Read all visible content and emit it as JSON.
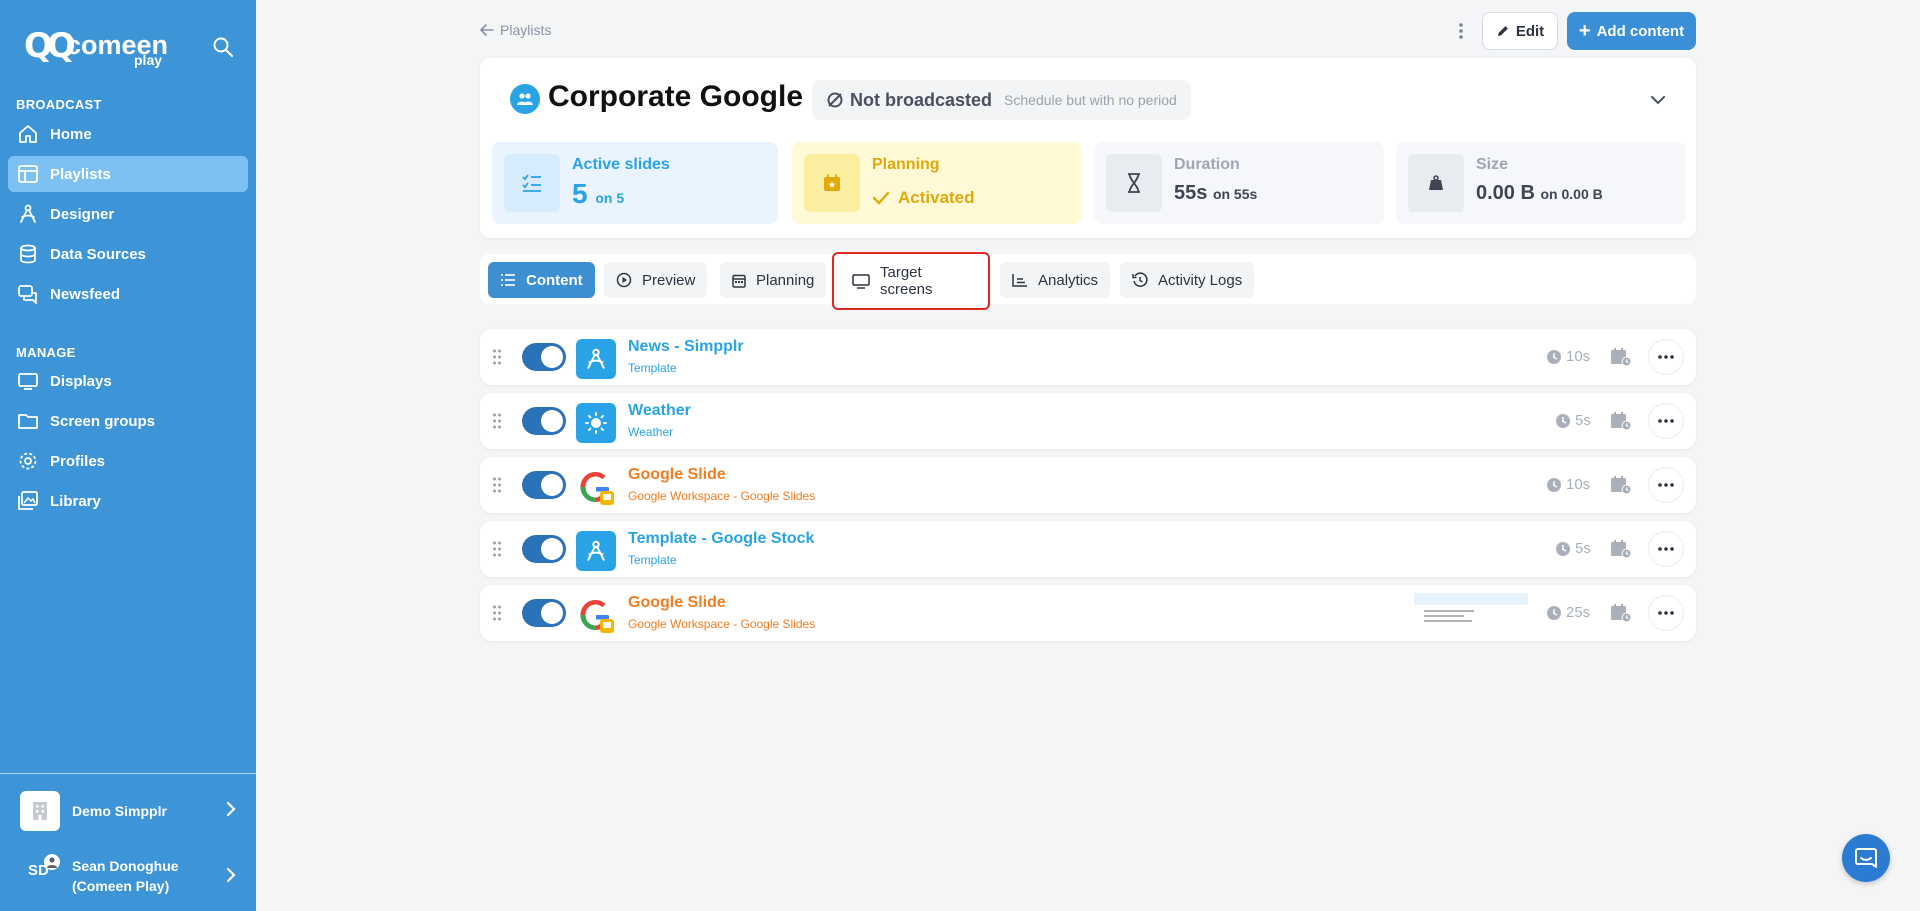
{
  "sidebar": {
    "brand": {
      "mark": "QQ",
      "name": "comeen",
      "sub": "play"
    },
    "broadcast_label": "BROADCAST",
    "broadcast_items": [
      {
        "label": "Home",
        "icon": "home-icon"
      },
      {
        "label": "Playlists",
        "icon": "playlist-icon",
        "active": true
      },
      {
        "label": "Designer",
        "icon": "designer-icon"
      },
      {
        "label": "Data Sources",
        "icon": "database-icon"
      },
      {
        "label": "Newsfeed",
        "icon": "newsfeed-icon"
      }
    ],
    "manage_label": "MANAGE",
    "manage_items": [
      {
        "label": "Displays",
        "icon": "monitor-icon"
      },
      {
        "label": "Screen groups",
        "icon": "folder-icon"
      },
      {
        "label": "Profiles",
        "icon": "gear-icon"
      },
      {
        "label": "Library",
        "icon": "image-library-icon"
      }
    ],
    "org": {
      "name": "Demo Simpplr"
    },
    "user": {
      "initials": "SD",
      "name_line1": "Sean Donoghue",
      "name_line2": "(Comeen Play)"
    }
  },
  "topbar": {
    "breadcrumb": "Playlists",
    "edit_label": "Edit",
    "add_label": "Add content"
  },
  "playlist": {
    "title": "Corporate Google",
    "status": "Not broadcasted",
    "status_note": "Schedule but with no period"
  },
  "stats": {
    "active": {
      "label": "Active slides",
      "value": "5",
      "of": "on 5"
    },
    "planning": {
      "label": "Planning",
      "value": "Activated"
    },
    "duration": {
      "label": "Duration",
      "value": "55s",
      "of": "on 55s"
    },
    "size": {
      "label": "Size",
      "value": "0.00 B",
      "of": "on 0.00 B"
    }
  },
  "tabs": [
    {
      "label": "Content",
      "active": true
    },
    {
      "label": "Preview"
    },
    {
      "label": "Planning"
    },
    {
      "label": "Target screens",
      "highlighted": true
    },
    {
      "label": "Analytics"
    },
    {
      "label": "Activity Logs"
    }
  ],
  "slides": [
    {
      "title": "News - Simpplr",
      "subtitle": "Template",
      "duration": "10s",
      "kind": "template",
      "enabled": true
    },
    {
      "title": "Weather",
      "subtitle": "Weather",
      "duration": "5s",
      "kind": "weather",
      "enabled": true
    },
    {
      "title": "Google Slide",
      "subtitle": "Google Workspace - Google Slides",
      "duration": "10s",
      "kind": "google",
      "enabled": true
    },
    {
      "title": "Template - Google Stock",
      "subtitle": "Template",
      "duration": "5s",
      "kind": "template",
      "enabled": true
    },
    {
      "title": "Google Slide",
      "subtitle": "Google Workspace - Google Slides",
      "duration": "25s",
      "kind": "google",
      "enabled": true
    }
  ],
  "colors": {
    "sidebar": "#3d94d6",
    "accent": "#2aa3e6",
    "google_orange": "#f57c1f",
    "planning_yellow": "#e0a90b",
    "highlight_red": "#e0271f"
  }
}
